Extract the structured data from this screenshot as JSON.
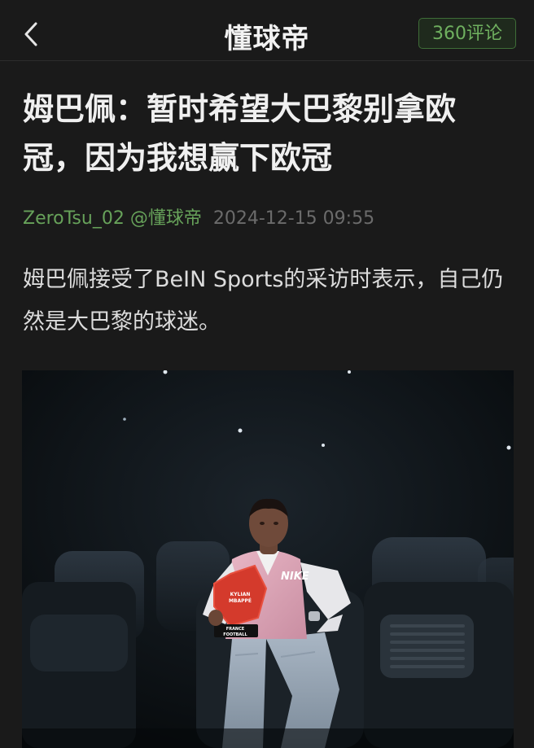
{
  "header": {
    "back_icon": "chevron-left-icon",
    "brand": "懂球帝",
    "comments_label": "360评论"
  },
  "article": {
    "title": "姆巴佩：暂时希望大巴黎别拿欧冠，因为我想赢下欧冠",
    "author": "ZeroTsu_02 @懂球帝",
    "date": "2024-12-15 09:55",
    "lead": "姆巴佩接受了BeIN Sports的采访时表示，自己仍然是大巴黎的球迷。"
  },
  "photo": {
    "description_icon": "player-photo",
    "trophy_text_1": "KYLIAN",
    "trophy_text_2": "MBAPPÉ",
    "trophy_base_1": "FRANCE",
    "trophy_base_2": "FOOTBALL"
  },
  "colors": {
    "background": "#1a1a1a",
    "accent_green": "#67a25a",
    "comments_border": "#3f6e38",
    "date_gray": "#6b6b6b"
  }
}
